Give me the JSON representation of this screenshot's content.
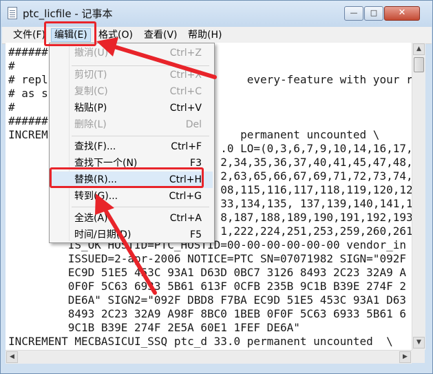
{
  "window": {
    "title": "ptc_licfile - 记事本",
    "controls": {
      "minimize": "—",
      "maximize": "□",
      "close": "✕"
    }
  },
  "menubar": [
    {
      "id": "file",
      "label": "文件(F)"
    },
    {
      "id": "edit",
      "label": "编辑(E)",
      "active": true
    },
    {
      "id": "format",
      "label": "格式(O)"
    },
    {
      "id": "view",
      "label": "查看(V)"
    },
    {
      "id": "help",
      "label": "帮助(H)"
    }
  ],
  "edit_menu": [
    {
      "label": "撤消(U)",
      "shortcut": "Ctrl+Z",
      "enabled": false
    },
    {
      "label": "剪切(T)",
      "shortcut": "Ctrl+X",
      "enabled": false
    },
    {
      "label": "复制(C)",
      "shortcut": "Ctrl+C",
      "enabled": false
    },
    {
      "label": "粘贴(P)",
      "shortcut": "Ctrl+V",
      "enabled": true
    },
    {
      "label": "删除(L)",
      "shortcut": "Del",
      "enabled": false
    },
    {
      "label": "查找(F)...",
      "shortcut": "Ctrl+F",
      "enabled": true
    },
    {
      "label": "查找下一个(N)",
      "shortcut": "F3",
      "enabled": true
    },
    {
      "label": "替换(R)...",
      "shortcut": "Ctrl+H",
      "enabled": true,
      "highlighted": true
    },
    {
      "label": "转到(G)...",
      "shortcut": "Ctrl+G",
      "enabled": true
    },
    {
      "label": "全选(A)",
      "shortcut": "Ctrl+A",
      "enabled": true
    },
    {
      "label": "时间/日期(D)",
      "shortcut": "F5",
      "enabled": true
    }
  ],
  "editor_lines": [
    "######",
    "#",
    "# repl                              every-feature with your rea",
    "# as s",
    "#",
    "######",
    "INCREM                             permanent uncounted \\",
    "                                .0 LO=(0,3,6,7,9,10,14,16,17,",
    "                                2,34,35,36,37,40,41,45,47,48,",
    "                                2,63,65,66,67,69,71,72,73,74,",
    "                                08,115,116,117,118,119,120,12",
    "                                33,134,135, 137,139,140,141,1",
    "                                8,187,188,189,190,191,192,193",
    "                                1,222,224,251,253,259,260,261",
    "         IS_OK HOSTID=PTC_HOSTID=00-00-00-00-00-00 vendor_in",
    "         ISSUED=2-apr-2006 NOTICE=PTC SN=07071982 SIGN=\"092F",
    "         EC9D 51E5 453C 93A1 D63D 0BC7 3126 8493 2C23 32A9 A",
    "         0F0F 5C63 6933 5B61 613F 0CFB 235B 9C1B B39E 274F 2",
    "         DE6A\" SIGN2=\"092F DBD8 F7BA EC9D 51E5 453C 93A1 D63",
    "         8493 2C23 32A9 A98F 8BC0 1BEB 0F0F 5C63 6933 5B61 6",
    "         9C1B B39E 274F 2E5A 60E1 1FEF DE6A\"",
    "INCREMENT MECBASICUI_SSQ ptc_d 33.0 permanent uncounted  \\"
  ],
  "scrollbar": {
    "up": "▲",
    "down": "▼",
    "left": "◀",
    "right": "▶"
  },
  "annotation_color": "#e8242a"
}
